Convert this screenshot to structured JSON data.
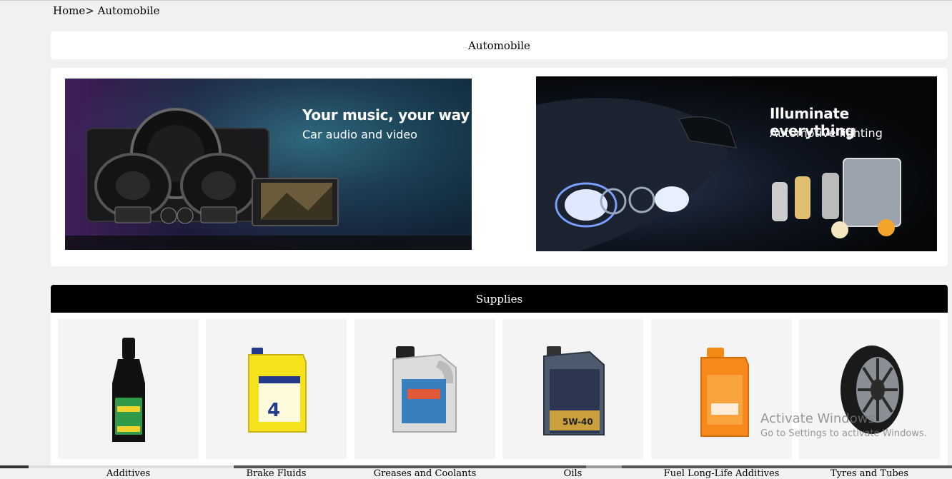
{
  "breadcrumb": {
    "home": "Home",
    "separator": ">",
    "current": " Automobile"
  },
  "page_title": "Automobile",
  "banners": [
    {
      "heading": "Your music, your way",
      "subheading": "Car audio and video"
    },
    {
      "heading": "Illuminate everything",
      "subheading": "Automotive lighting"
    }
  ],
  "section_title": "Supplies",
  "products": [
    {
      "name": "Additives",
      "icon": "fuel-system-cleaner-bottle"
    },
    {
      "name": "Brake Fluids",
      "icon": "brake-fluid-jerrycan"
    },
    {
      "name": "Greases and Coolants",
      "icon": "motor-oil-can"
    },
    {
      "name": "Oils",
      "icon": "engine-oil-can"
    },
    {
      "name": "Fuel Long-Life Additives",
      "icon": "coolant-bottle"
    },
    {
      "name": "Tyres and Tubes",
      "icon": "tyre"
    }
  ],
  "watermark": {
    "line1": "Activate Windows",
    "line2": "Go to Settings to activate Windows."
  }
}
